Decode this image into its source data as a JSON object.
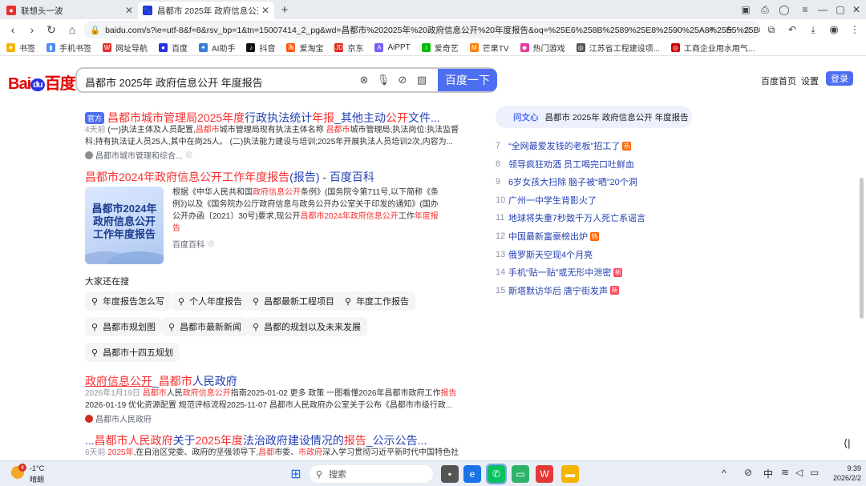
{
  "browser": {
    "tabs": [
      {
        "title": "联想头一波",
        "active": false
      },
      {
        "title": "昌都市 2025年 政府信息公开 年度",
        "active": true
      }
    ],
    "new_tab": "+",
    "url": "baidu.com/s?ie=utf-8&f=8&rsv_bp=1&tn=15007414_2_pg&wd=昌都市%202025年%20政府信息公开%20年度报告&oq=%25E6%258B%2589%25E8%2590%25A8%25E5%25B8%2582%..."
  },
  "bookmarks": [
    "书签",
    "手机书签",
    "网址导航",
    "百度",
    "AI助手",
    "抖音",
    "爱淘宝",
    "京东",
    "AiPPT",
    "爱奇艺",
    "芒果TV",
    "热门游戏",
    "江苏省工程建设项...",
    "工商企业用水用气..."
  ],
  "baidu": {
    "logo_left": "Bai",
    "logo_mid": "du",
    "logo_right": "百度",
    "query": "昌都市 2025年 政府信息公开 年度报告",
    "search_button": "百度一下",
    "home": "百度首页",
    "settings": "设置",
    "login": "登录"
  },
  "results": {
    "r1": {
      "badge": "官方",
      "title_a": "昌都市城市管理局",
      "title_b": "2025年度",
      "title_c": "行政执法统计",
      "title_d": "年报",
      "title_e": "_其他主动",
      "title_f": "公开",
      "title_g": "文件...",
      "snip1_a": "4天前",
      "snip1_b": " (一)执法主体及人员配置,",
      "snip1_c": "昌都市",
      "snip1_d": "城市管理局现有执法主体名称 ",
      "snip1_e": "昌都市",
      "snip1_f": "城市管理局;执法岗位:执法监督",
      "snip2": "科;持有执法证人员25人,其中在岗25人。 (二)执法能力建设与培训;2025年开展执法人员培训2次,内容为...",
      "source": "昌都市城市管理和综合..."
    },
    "r2": {
      "title_a": "昌都市",
      "title_b": "2024年",
      "title_c": "政府信息公开",
      "title_d": "工作",
      "title_e": "年度报告",
      "title_f": "(报告) - 百度百科",
      "thumb_text": "昌都市2024年政府信息公开工作年度报告",
      "snip1_a": "根据《中华人民共和国",
      "snip1_b": "政府信息公开",
      "snip1_c": "条例》(国务院令第711号,以下简称《条",
      "snip2": "例》)以及《国务院办公厅政府信息与政务公开办公室关于印发的通知》(国办",
      "snip3_a": "公开办函〔2021〕30号)要求,现公开",
      "snip3_b": "昌都市2024年政府信息公开",
      "snip3_c": "工作",
      "snip3_d": "年度报",
      "snip4": "告",
      "source": "百度百科"
    },
    "related_title": "大家还在搜",
    "related": [
      "年度报告怎么写",
      "个人年度报告",
      "昌都最新工程项目",
      "年度工作报告",
      "昌都市规划图",
      "昌都市最新新闻",
      "昌都的规划以及未来发展",
      "昌都市十四五规划"
    ],
    "r3": {
      "title_a": "政府信息公开",
      "title_b": "_",
      "title_c": "昌都市",
      "title_d": "人民政府",
      "snip1_a": "2026年1月19日 ",
      "snip1_b": "昌都市",
      "snip1_c": "人民",
      "snip1_d": "政府信息公开",
      "snip1_e": "指南2025-01-02 更多 政策 一图看懂2026年昌都市政府工作",
      "snip1_f": "报告",
      "snip2": "2026-01-19 优化资源配置 规范评标流程2025-11-07 昌都市人民政府办公室关于公布《昌都市市级行政...",
      "source": "昌都市人民政府"
    },
    "r4": {
      "title_a": "...",
      "title_b": "昌都市",
      "title_c": "人民",
      "title_d": "政府",
      "title_e": "关于",
      "title_f": "2025年度",
      "title_g": "法治政府建设情况的",
      "title_h": "报告",
      "title_i": "_公示公告...",
      "snip_a": "6天前 ",
      "snip_b": "2025年",
      "snip_c": ",在自治区党委、政府的坚强领导下,",
      "snip_d": "昌都",
      "snip_e": "市委、",
      "snip_f": "市政府",
      "snip_g": "深入学习贯彻习近平新时代中国特色社"
    }
  },
  "right": {
    "ai_label": "问文心",
    "ai_query": "昌都市 2025年 政府信息公开 年度报告",
    "hot": [
      {
        "n": "7",
        "t": "“全网最爱发钱的老板”招工了",
        "badge": "热",
        "color": "#ff6600"
      },
      {
        "n": "8",
        "t": "领导疯狂劝酒 员工喝完口吐鲜血",
        "badge": "",
        "color": ""
      },
      {
        "n": "9",
        "t": "6岁女孩大扫除 脑子被“晒”20个洞",
        "badge": "",
        "color": ""
      },
      {
        "n": "10",
        "t": "广州一中学生背影火了",
        "badge": "",
        "color": ""
      },
      {
        "n": "11",
        "t": "地球将失重7秒致千万人死亡系谣言",
        "badge": "",
        "color": ""
      },
      {
        "n": "12",
        "t": "中国最新富豪榜出炉",
        "badge": "热",
        "color": "#ff6600"
      },
      {
        "n": "13",
        "t": "俄罗斯天空现4个月亮",
        "badge": "",
        "color": ""
      },
      {
        "n": "14",
        "t": "手机“贴一贴”或无形中泄密",
        "badge": "新",
        "color": "#ff455b"
      },
      {
        "n": "15",
        "t": "斯塔默访华后 唐宁街发声",
        "badge": "新",
        "color": "#ff455b"
      }
    ]
  },
  "taskbar": {
    "weather_temp": "-1°C",
    "weather_desc": "晴朗",
    "weather_badge": "4",
    "search": "搜索",
    "ime": "中",
    "time": "9:39",
    "date": "2026/2/2"
  }
}
